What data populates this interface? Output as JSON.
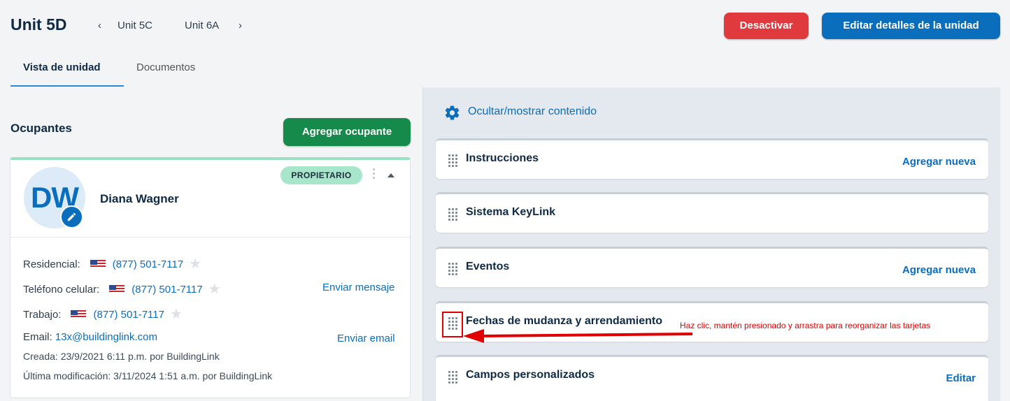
{
  "header": {
    "title": "Unit 5D",
    "prev_unit": "Unit 5C",
    "next_unit": "Unit 6A",
    "deactivate_label": "Desactivar",
    "edit_label": "Editar detalles de la unidad"
  },
  "tabs": [
    {
      "label": "Vista de unidad",
      "active": true
    },
    {
      "label": "Documentos",
      "active": false
    }
  ],
  "occupants": {
    "title": "Ocupantes",
    "add_label": "Agregar ocupante",
    "card": {
      "initials": "DW",
      "name": "Diana Wagner",
      "badge": "PROPIETARIO",
      "phones": [
        {
          "label": "Residencial:",
          "number": "(877) 501-7117"
        },
        {
          "label": "Teléfono celular:",
          "number": "(877) 501-7117",
          "action": "Enviar mensaje"
        },
        {
          "label": "Trabajo:",
          "number": "(877) 501-7117"
        }
      ],
      "email_label": "Email:",
      "email": "13x@buildinglink.com",
      "email_action": "Enviar email",
      "created": "Creada:  23/9/2021 6:11 p.m. por BuildingLink",
      "modified": "Última modificación:  3/11/2024 1:51 a.m. por BuildingLink"
    }
  },
  "content": {
    "toggle_label": "Ocultar/mostrar contenido",
    "cards": [
      {
        "title": "Instrucciones",
        "action": "Agregar nueva"
      },
      {
        "title": "Sistema KeyLink",
        "action": ""
      },
      {
        "title": "Eventos",
        "action": "Agregar nueva"
      },
      {
        "title": "Fechas de mudanza y arrendamiento",
        "action": ""
      },
      {
        "title": "Campos personalizados",
        "action": "Editar"
      }
    ],
    "annotation": "Haz clic, mantén presionado y arrastra para reorganizar las tarjetas"
  },
  "colors": {
    "primary": "#0a6ebd",
    "danger": "#e03a3e",
    "success": "#158a4b",
    "badge": "#a8e6cc",
    "annotation": "#e00000"
  },
  "icons": {
    "prev": "chevron-left-icon",
    "next": "chevron-right-icon",
    "settings": "gear-icon",
    "drag": "drag-handle-icon",
    "edit": "pencil-icon",
    "favorite": "star-icon",
    "flag": "us-flag-icon"
  }
}
